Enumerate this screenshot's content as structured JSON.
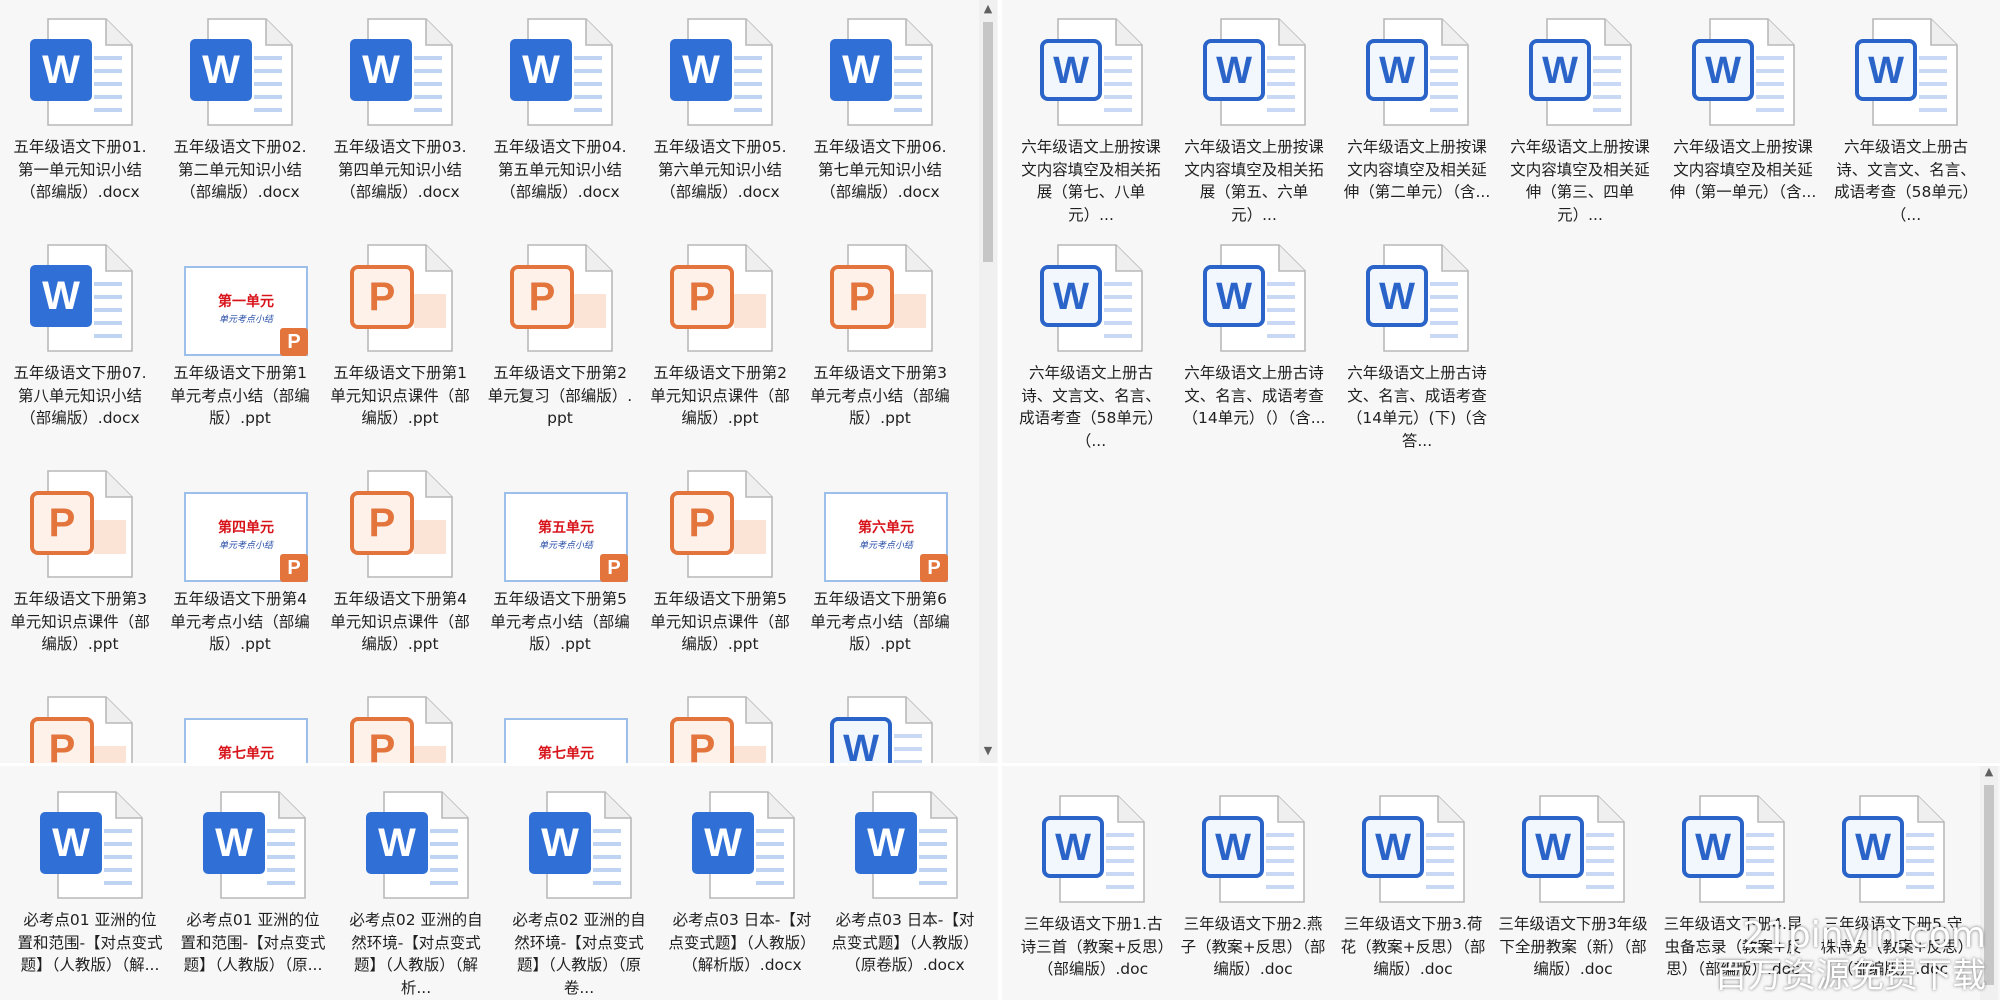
{
  "colors": {
    "word_solid": "#2f6fd6",
    "word_outline": "#2b64c8",
    "ppt": "#e3743b",
    "thumb_title": "#d8141b",
    "thumb_sub": "#2a4fa8"
  },
  "panes": [
    {
      "id": "q1",
      "items": [
        {
          "icon": "word-solid",
          "name": "五年级语文下册01.第一单元知识小结（部编版）.docx"
        },
        {
          "icon": "word-solid",
          "name": "五年级语文下册02.第二单元知识小结（部编版）.docx"
        },
        {
          "icon": "word-solid",
          "name": "五年级语文下册03.第四单元知识小结（部编版）.docx"
        },
        {
          "icon": "word-solid",
          "name": "五年级语文下册04.第五单元知识小结（部编版）.docx"
        },
        {
          "icon": "word-solid",
          "name": "五年级语文下册05.第六单元知识小结（部编版）.docx"
        },
        {
          "icon": "word-solid",
          "name": "五年级语文下册06.第七单元知识小结（部编版）.docx"
        },
        {
          "icon": "word-solid",
          "name": "五年级语文下册07.第八单元知识小结（部编版）.docx"
        },
        {
          "icon": "thumb",
          "thumb_title": "第一单元",
          "thumb_sub": "单元考点小结",
          "name": "五年级语文下册第1单元考点小结（部编版）.ppt"
        },
        {
          "icon": "ppt",
          "name": "五年级语文下册第1单元知识点课件（部编版）.ppt"
        },
        {
          "icon": "ppt",
          "name": "五年级语文下册第2单元复习（部编版）.ppt"
        },
        {
          "icon": "ppt",
          "name": "五年级语文下册第2单元知识点课件（部编版）.ppt"
        },
        {
          "icon": "ppt",
          "name": "五年级语文下册第3单元考点小结（部编版）.ppt"
        },
        {
          "icon": "ppt",
          "name": "五年级语文下册第3单元知识点课件（部编版）.ppt"
        },
        {
          "icon": "thumb",
          "thumb_title": "第四单元",
          "thumb_sub": "单元考点小结",
          "name": "五年级语文下册第4单元考点小结（部编版）.ppt"
        },
        {
          "icon": "ppt",
          "name": "五年级语文下册第4单元知识点课件（部编版）.ppt"
        },
        {
          "icon": "thumb",
          "thumb_title": "第五单元",
          "thumb_sub": "单元考点小结",
          "name": "五年级语文下册第5单元考点小结（部编版）.ppt"
        },
        {
          "icon": "ppt",
          "name": "五年级语文下册第5单元知识点课件（部编版）.ppt"
        },
        {
          "icon": "thumb",
          "thumb_title": "第六单元",
          "thumb_sub": "单元考点小结",
          "name": "五年级语文下册第6单元考点小结（部编版）.ppt"
        },
        {
          "icon": "ppt",
          "name": ""
        },
        {
          "icon": "thumb",
          "thumb_title": "第七单元",
          "thumb_sub": "",
          "name": ""
        },
        {
          "icon": "ppt",
          "name": ""
        },
        {
          "icon": "thumb",
          "thumb_title": "第七单元",
          "thumb_sub": "",
          "name": ""
        },
        {
          "icon": "ppt",
          "name": ""
        },
        {
          "icon": "word-outline",
          "name": ""
        }
      ]
    },
    {
      "id": "q2",
      "items": [
        {
          "icon": "word-outline",
          "name": "六年级语文上册按课文内容填空及相关拓展（第七、八单元）..."
        },
        {
          "icon": "word-outline",
          "name": "六年级语文上册按课文内容填空及相关拓展（第五、六单元）..."
        },
        {
          "icon": "word-outline",
          "name": "六年级语文上册按课文内容填空及相关延伸（第二单元）（含..."
        },
        {
          "icon": "word-outline",
          "name": "六年级语文上册按课文内容填空及相关延伸（第三、四单元）..."
        },
        {
          "icon": "word-outline",
          "name": "六年级语文上册按课文内容填空及相关延伸（第一单元）（含..."
        },
        {
          "icon": "word-outline",
          "name": "六年级语文上册古诗、文言文、名言、成语考查（58单元）（..."
        },
        {
          "icon": "word-outline",
          "name": "六年级语文上册古诗、文言文、名言、成语考查（58单元）（..."
        },
        {
          "icon": "word-outline",
          "name": "六年级语文上册古诗文、名言、成语考查（14单元）（）（含..."
        },
        {
          "icon": "word-outline",
          "name": "六年级语文上册古诗文、名言、成语考查（14单元）(下)（含答..."
        }
      ]
    },
    {
      "id": "q3",
      "items": [
        {
          "icon": "word-solid",
          "name": "必考点01 亚洲的位置和范围-【对点变式题】（人教版）（解..."
        },
        {
          "icon": "word-solid",
          "name": "必考点01 亚洲的位置和范围-【对点变式题】（人教版）（原..."
        },
        {
          "icon": "word-solid",
          "name": "必考点02 亚洲的自然环境-【对点变式题】（人教版）（解析..."
        },
        {
          "icon": "word-solid",
          "name": "必考点02 亚洲的自然环境-【对点变式题】（人教版）（原卷..."
        },
        {
          "icon": "word-solid",
          "name": "必考点03 日本-【对点变式题】（人教版）（解析版）.docx"
        },
        {
          "icon": "word-solid",
          "name": "必考点03 日本-【对点变式题】（人教版）（原卷版）.docx"
        }
      ]
    },
    {
      "id": "q4",
      "items": [
        {
          "icon": "word-outline",
          "name": "三年级语文下册1.古诗三首（教案+反思）（部编版）.doc"
        },
        {
          "icon": "word-outline",
          "name": "三年级语文下册2.燕子（教案+反思）（部编版）.doc"
        },
        {
          "icon": "word-outline",
          "name": "三年级语文下册3.荷花（教案+反思）（部编版）.doc"
        },
        {
          "icon": "word-outline",
          "name": "三年级语文下册3年级下全册教案（新）（部编版）.doc"
        },
        {
          "icon": "word-outline",
          "name": "三年级语文下册4.昆虫备忘录（教案+反思）（部编版）.doc"
        },
        {
          "icon": "word-outline",
          "name": "三年级语文下册5.守株待兔（教案+反思）（部编版）.doc"
        }
      ]
    }
  ],
  "watermark": {
    "line1": "21pinyin.com",
    "line2": "百万资源免费下载"
  }
}
